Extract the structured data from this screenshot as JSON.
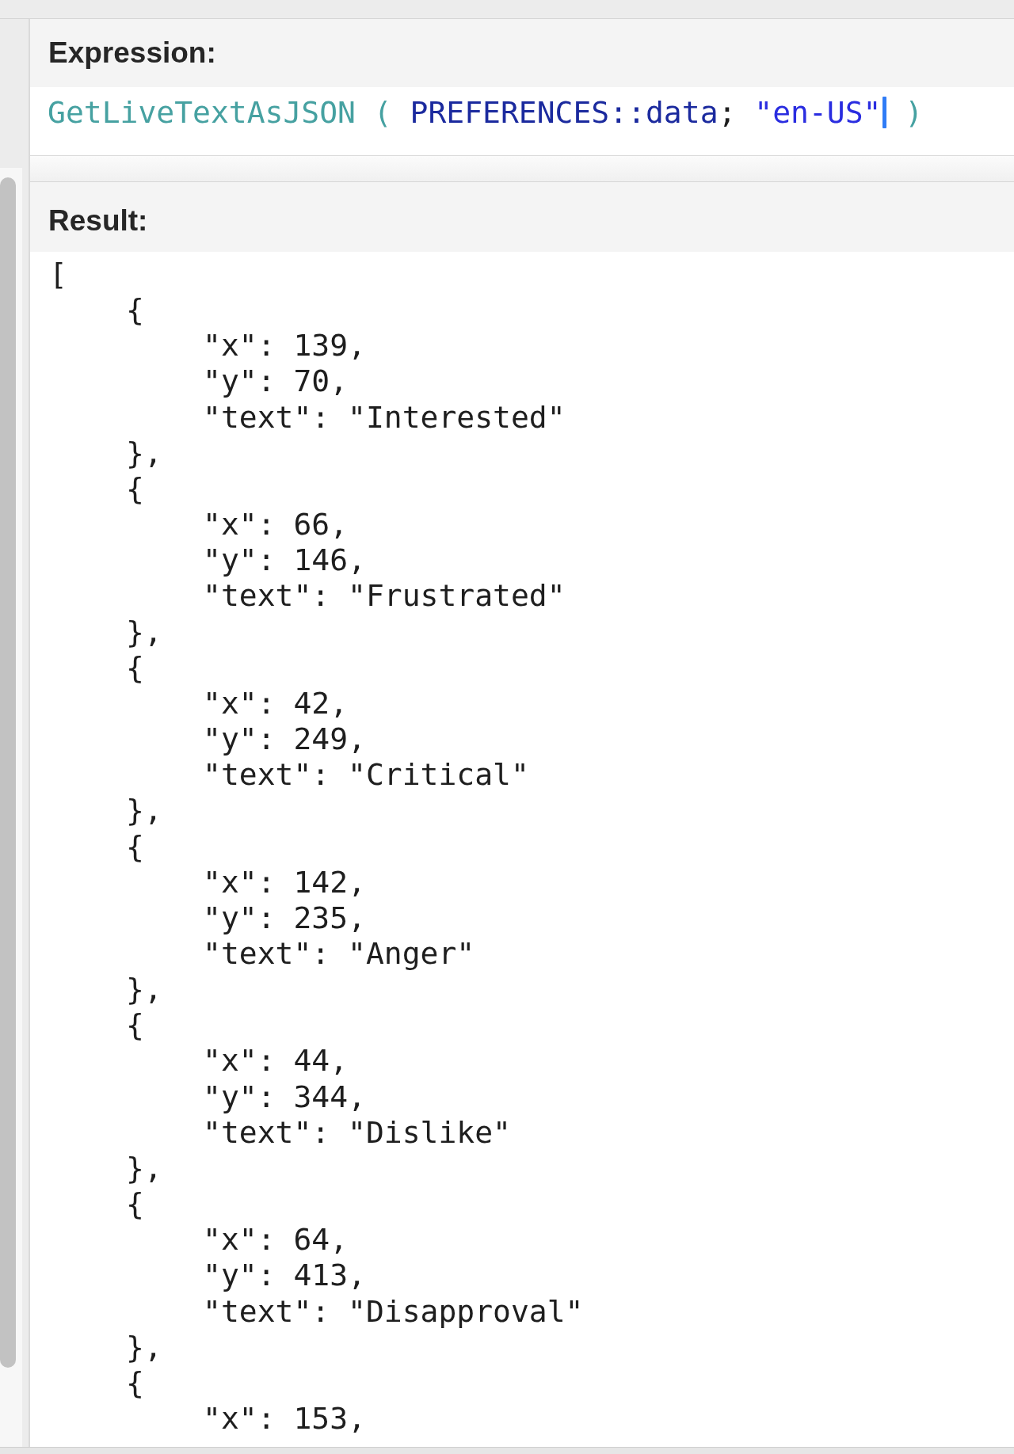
{
  "expression": {
    "title": "Expression:",
    "tokens": [
      {
        "kind": "function",
        "text": "GetLiveTextAsJSON "
      },
      {
        "kind": "paren",
        "text": "( "
      },
      {
        "kind": "field",
        "text": "PREFERENCES::data"
      },
      {
        "kind": "punct",
        "text": "; "
      },
      {
        "kind": "string",
        "text": "\"en-US\""
      },
      {
        "kind": "cursor"
      },
      {
        "kind": "paren",
        "text": " )"
      }
    ]
  },
  "result": {
    "title": "Result:",
    "lines": [
      {
        "text": "[",
        "children": [
          {
            "text": "{",
            "children": [
              {
                "text": "\"x\": 139,"
              },
              {
                "text": "\"y\": 70,"
              },
              {
                "text": "\"text\": \"Interested\""
              }
            ]
          },
          {
            "text": "},"
          },
          {
            "text": "{",
            "children": [
              {
                "text": "\"x\": 66,"
              },
              {
                "text": "\"y\": 146,"
              },
              {
                "text": "\"text\": \"Frustrated\""
              }
            ]
          },
          {
            "text": "},"
          },
          {
            "text": "{",
            "children": [
              {
                "text": "\"x\": 42,"
              },
              {
                "text": "\"y\": 249,"
              },
              {
                "text": "\"text\": \"Critical\""
              }
            ]
          },
          {
            "text": "},"
          },
          {
            "text": "{",
            "children": [
              {
                "text": "\"x\": 142,"
              },
              {
                "text": "\"y\": 235,"
              },
              {
                "text": "\"text\": \"Anger\""
              }
            ]
          },
          {
            "text": "},"
          },
          {
            "text": "{",
            "children": [
              {
                "text": "\"x\": 44,"
              },
              {
                "text": "\"y\": 344,"
              },
              {
                "text": "\"text\": \"Dislike\""
              }
            ]
          },
          {
            "text": "},"
          },
          {
            "text": "{",
            "children": [
              {
                "text": "\"x\": 64,"
              },
              {
                "text": "\"y\": 413,"
              },
              {
                "text": "\"text\": \"Disapproval\""
              }
            ]
          },
          {
            "text": "},"
          },
          {
            "text": "{",
            "children": [
              {
                "text": "\"x\": 153,"
              }
            ]
          }
        ]
      }
    ]
  }
}
